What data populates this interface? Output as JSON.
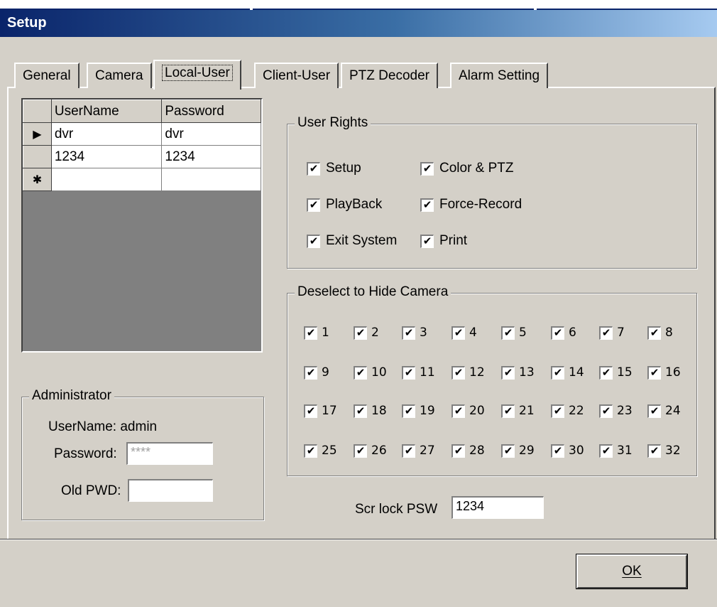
{
  "window": {
    "title": "Setup"
  },
  "tabs": [
    "General",
    "Camera",
    "Local-User",
    "Client-User",
    "PTZ Decoder",
    "Alarm Setting"
  ],
  "active_tab": "Local-User",
  "user_table": {
    "columns": [
      "UserName",
      "Password"
    ],
    "rows": [
      {
        "indicator": "▶",
        "username": "dvr",
        "password": "dvr"
      },
      {
        "indicator": "",
        "username": "1234",
        "password": "1234"
      },
      {
        "indicator": "✱",
        "username": "",
        "password": ""
      }
    ]
  },
  "user_rights": {
    "title": "User Rights",
    "items": [
      {
        "label": "Setup",
        "checked": true
      },
      {
        "label": "Color & PTZ",
        "checked": true
      },
      {
        "label": "PlayBack",
        "checked": true
      },
      {
        "label": "Force-Record",
        "checked": true
      },
      {
        "label": "Exit System",
        "checked": true
      },
      {
        "label": "Print",
        "checked": true
      }
    ]
  },
  "cameras": {
    "title": "Deselect to Hide Camera",
    "items": [
      "1",
      "2",
      "3",
      "4",
      "5",
      "6",
      "7",
      "8",
      "9",
      "10",
      "11",
      "12",
      "13",
      "14",
      "15",
      "16",
      "17",
      "18",
      "19",
      "20",
      "21",
      "22",
      "23",
      "24",
      "25",
      "26",
      "27",
      "28",
      "29",
      "30",
      "31",
      "32"
    ],
    "checked_mark": "✔"
  },
  "administrator": {
    "title": "Administrator",
    "username_label": "UserName: admin",
    "password_label": "Password:",
    "password_value": "****",
    "old_pwd_label": "Old PWD:",
    "old_pwd_value": ""
  },
  "screen_lock": {
    "label": "Scr lock PSW",
    "value": "1234"
  },
  "ok_button": {
    "label": "OK"
  }
}
